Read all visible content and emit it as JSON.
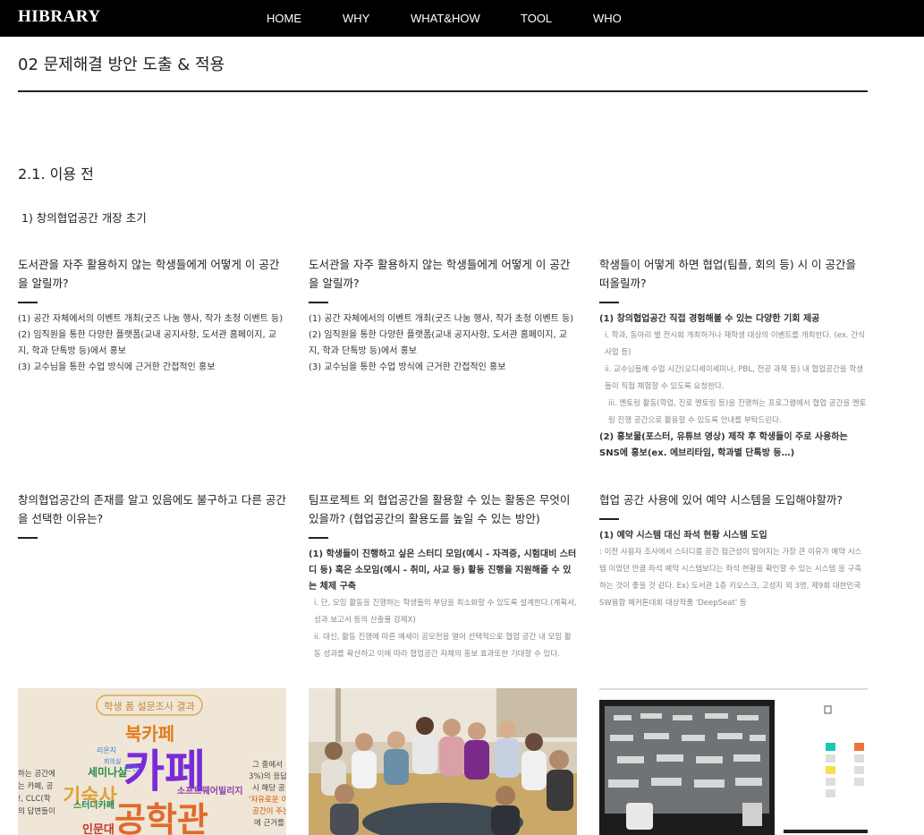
{
  "header": {
    "logo": "HIBRARY",
    "nav": [
      "HOME",
      "WHY",
      "WHAT&HOW",
      "TOOL",
      "WHO"
    ]
  },
  "page_title": "02 문제해결 방안 도출 & 적용",
  "section_title": "2.1. 이용 전",
  "sub_title": "1) 창의협업공간 개장 초기",
  "cards": [
    {
      "title": "도서관을 자주 활용하지 않는 학생들에게 어떻게 이 공간을 알릴까?",
      "lines": [
        "(1) 공간 자체에서의 이벤트 개최(굿즈 나눔 행사, 작가 초청 이벤트 등)",
        "(2) 임직원을 통한 다양한 플랫폼(교내 공지사항, 도서관 홈페이지, 교지, 학과 단톡방 등)에서 홍보",
        "(3) 교수님을 통한 수업 방식에 근거한 간접적인 홍보"
      ]
    },
    {
      "title": "도서관을 자주 활용하지 않는 학생들에게 어떻게 이 공간을 알릴까?",
      "lines": [
        "(1) 공간 자체에서의 이벤트 개최(굿즈 나눔 행사, 작가 초청 이벤트 등)",
        "(2) 임직원을 통한 다양한 플랫폼(교내 공지사항, 도서관 홈페이지, 교지, 학과 단톡방 등)에서 홍보",
        "(3) 교수님을 통한 수업 방식에 근거한 간접적인 홍보"
      ]
    },
    {
      "title": "학생들이 어떻게 하면 협업(팀플, 회의 등) 시 이 공간을 떠올릴까?",
      "main1": "(1) 창의협업공간 직접 경험해볼 수 있는 다양한 기회 제공",
      "notes": [
        "i. 학과, 동아리 별 전시회 개최하거나 재학생 대상의 이벤트를 개최한다. (ex. 간식사업 등)",
        "ii. 교수님들께 수업 시간(오디세이세미나, PBL, 전공 과목 등) 내 협업공간을 학생들이 직접 체험할 수 있도록 요청한다.",
        "iii. 멘토링 활동(학업, 진로 멘토링 등)을 진행하는 프로그램에서 협업 공간을 멘토링 진행 공간으로 활용할 수 있도록 안내를 부탁드린다."
      ],
      "main2": "(2) 홍보물(포스터, 유튜브 영상) 제작 후 학생들이 주로 사용하는 SNS에 홍보(ex. 에브리타임, 학과별 단톡방 등…)"
    },
    {
      "title": "창의협업공간의 존재를 알고 있음에도 불구하고 다른 공간을 선택한 이유는?"
    },
    {
      "title": "팀프로젝트 외 협업공간을 활용할 수 있는 활동은 무엇이 있을까? (협업공간의 활용도를 높일 수 있는 방안)",
      "main1": "(1) 학생들이 진행하고 싶은 스터디 모임(예시 - 자격증, 시험대비 스터디 등) 혹은 소모임(예시 - 취미, 사교 등) 활동 진행을 지원해줄 수 있는 체제 구축",
      "notes": [
        "i. 단, 모임 활동을 진행하는 학생들의 부담을 최소화할 수 있도록 설계한다.(계획서, 성과 보고서 등의 산출물 강제X)",
        "ii. 대신, 활동 진행에 따른 예세이 공모전을 열어 선택적으로 협업 공간 내 모임 활동 성과를 확산하고 이에 따라 협업공간 자체의 홍보 효과또한 기대할 수 있다."
      ]
    },
    {
      "title": "협업 공간 사용에 있어 예약 시스템을 도입해야할까?",
      "main1": "(1) 예약 시스템 대신 좌석 현황 시스템 도입",
      "notes": [
        ": 이전 사용자 조사에서 스터디룸 공간 접근성이 떨어지는 가장 큰 이유가 예약 시스템 이었던 만큼 좌석 예약 시스템보다는 좌석 현황을 확인할 수 있는 시스템 을 구축하는 것이 좋을 것 같다. Ex) 도서관 1층 키오스크, 고성지 외 3명, 제9회 대한민국 SW융합 해커톤대회 대상작품 'DeepSeat' 등"
      ]
    }
  ],
  "image1": {
    "banner": "학생 폼 설문조사 결과",
    "words": [
      "북카페",
      "카페",
      "공학관",
      "기숙사",
      "세미나실",
      "스터디카페",
      "인문대",
      "소프트웨어빌리지",
      "리온지",
      "본관",
      "회의실"
    ],
    "left_text": [
      "하는 공간에",
      "는 카페, 공",
      "!, CLC(학",
      "의 답변들이"
    ],
    "right_text": [
      "그 중에서",
      "3%)의 응답",
      "시 해당 공",
      "'자유로운 이",
      "공간이 주는",
      "에 근거를"
    ]
  },
  "colors": {
    "header_bg": "#000000",
    "accent_purple": "#7a2bd8",
    "accent_orange": "#e07c1c"
  }
}
